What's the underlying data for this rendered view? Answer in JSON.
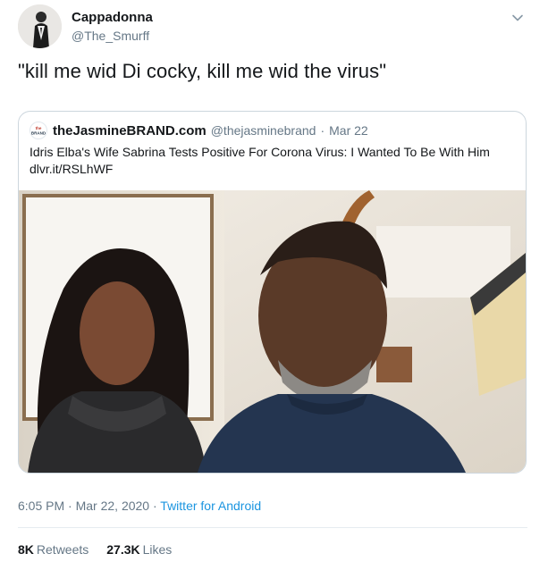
{
  "author": {
    "name": "Cappadonna",
    "handle": "@The_Smurff",
    "avatar_icon": "profile-photo"
  },
  "tweet": {
    "text": "\"kill me wid Di cocky, kill me wid the virus\""
  },
  "quoted_tweet": {
    "logo_text": "the BRAND",
    "name": "theJasmineBRAND.com",
    "handle": "@thejasminebrand",
    "date": "Mar 22",
    "text": "Idris Elba's Wife Sabrina Tests Positive For Corona Virus: I Wanted To Be With Him",
    "link": "dlvr.it/RSLhWF",
    "media_icon": "video-still-two-people"
  },
  "meta": {
    "time": "6:05 PM",
    "date": "Mar 22, 2020",
    "source": "Twitter for Android"
  },
  "stats": {
    "retweets_count": "8K",
    "retweets_label": "Retweets",
    "likes_count": "27.3K",
    "likes_label": "Likes"
  },
  "colors": {
    "link_blue": "#1b95e0",
    "secondary_text": "#657786",
    "border": "#ccd6dd"
  }
}
